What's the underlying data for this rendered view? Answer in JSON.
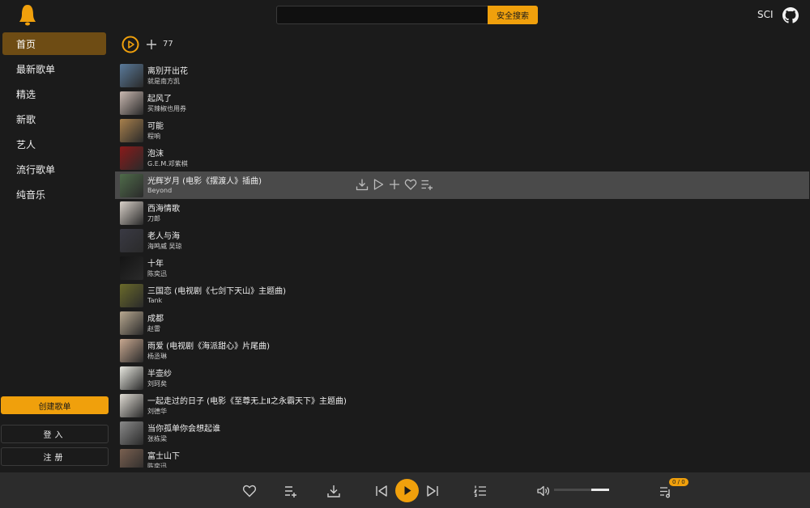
{
  "header": {
    "search_placeholder": "",
    "search_button": "安全搜索",
    "user_name": "SCI"
  },
  "sidebar": {
    "items": [
      {
        "label": "首页",
        "active": true
      },
      {
        "label": "最新歌单"
      },
      {
        "label": "精选"
      },
      {
        "label": "新歌"
      },
      {
        "label": "艺人"
      },
      {
        "label": "流行歌单"
      },
      {
        "label": "纯音乐"
      }
    ],
    "create_playlist": "创建歌单",
    "login": "登入",
    "register": "注册"
  },
  "toolbar": {
    "count": "77"
  },
  "songs": [
    {
      "title": "离别开出花",
      "artist": "就是南方凯",
      "cover": "#5a7a9a"
    },
    {
      "title": "起风了",
      "artist": "买辣椒也用券",
      "cover": "#c9b8b0"
    },
    {
      "title": "可能",
      "artist": "程响",
      "cover": "#a8804c"
    },
    {
      "title": "泡沫",
      "artist": "G.E.M.邓紫棋",
      "cover": "#8a1a1a"
    },
    {
      "title": "光辉岁月 (电影《摆渡人》插曲)",
      "artist": "Beyond",
      "cover": "#4f6b4a",
      "hover": true
    },
    {
      "title": "西海情歌",
      "artist": "刀郎",
      "cover": "#d8d0c8"
    },
    {
      "title": "老人与海",
      "artist": "海鸣威   吴琼",
      "cover": "#3a3a44"
    },
    {
      "title": "十年",
      "artist": "陈奕迅",
      "cover": "#141414"
    },
    {
      "title": "三国恋 (电视剧《七剑下天山》主题曲)",
      "artist": "Tank",
      "cover": "#6a6a2a"
    },
    {
      "title": "成都",
      "artist": "赵雷",
      "cover": "#b8a890"
    },
    {
      "title": "雨爱 (电视剧《海派甜心》片尾曲)",
      "artist": "杨丞琳",
      "cover": "#c8a890"
    },
    {
      "title": "半壶纱",
      "artist": "刘珂矣",
      "cover": "#e8e8e0"
    },
    {
      "title": "一起走过的日子 (电影《至尊无上Ⅱ之永霸天下》主题曲)",
      "artist": "刘德华",
      "cover": "#e0dcd4"
    },
    {
      "title": "当你孤单你会想起谁",
      "artist": "张栋梁",
      "cover": "#8a8a8a"
    },
    {
      "title": "富士山下",
      "artist": "陈奕迅",
      "cover": "#7a6050"
    }
  ],
  "player": {
    "volume": 0.35,
    "queue_badge": "0 / 0"
  },
  "colors": {
    "accent": "#f0a00c",
    "background": "#1b1b1b",
    "player_bg": "#2c2c2c"
  }
}
